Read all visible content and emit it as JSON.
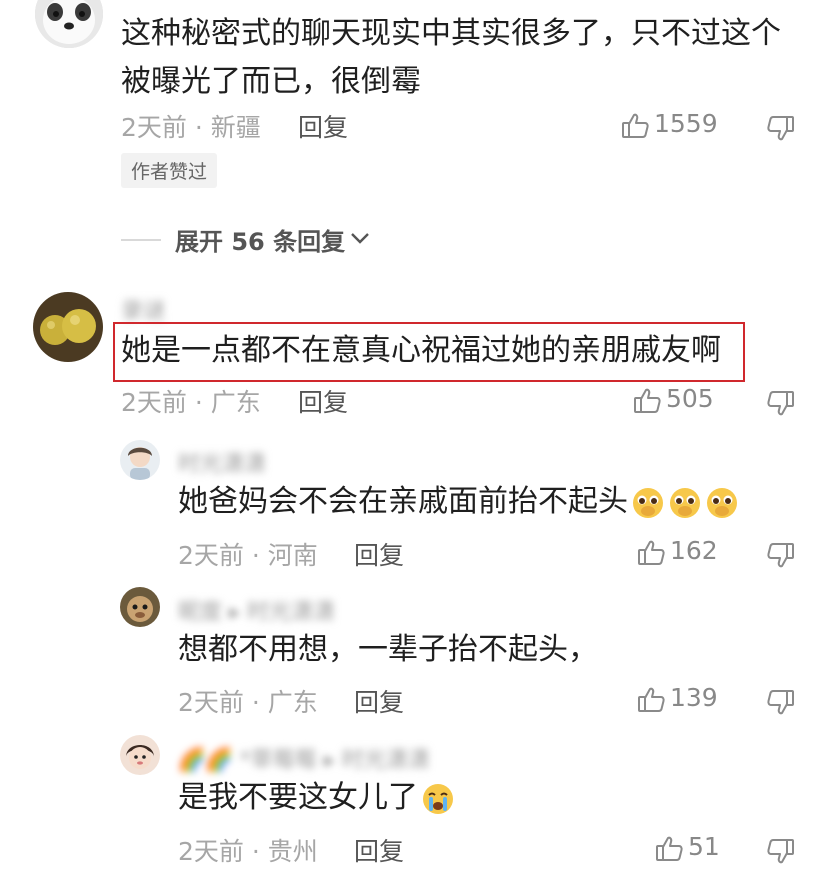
{
  "comments": [
    {
      "text_line1": "这种秘密式的聊天现实中其实很多了，只不过这个",
      "text_line2": "被曝光了而已，很倒霉",
      "time": "2天前",
      "location": "新疆",
      "reply_label": "回复",
      "likes": "1559",
      "badge": "作者赞过",
      "expand_label": "展开 56 条回复"
    },
    {
      "username": "录谜",
      "text": "她是一点都不在意真心祝福过她的亲朋戚友啊",
      "time": "2天前",
      "location": "广东",
      "reply_label": "回复",
      "likes": "505",
      "highlight_color": "#d0282d"
    }
  ],
  "replies": [
    {
      "username": "时光潇潇",
      "text": "她爸妈会不会在亲戚面前抬不起头",
      "time": "2天前",
      "location": "河南",
      "reply_label": "回复",
      "likes": "162"
    },
    {
      "username": "昵度 ▸ 时光潇潇",
      "text": "想都不用想，一辈子抬不起头，",
      "time": "2天前",
      "location": "广东",
      "reply_label": "回复",
      "likes": "139"
    },
    {
      "username": "🌈🌈 *草莓莓 ▸ 时光潇潇",
      "text": "是我不要这女儿了",
      "time": "2天前",
      "location": "贵州",
      "reply_label": "回复",
      "likes": "51"
    }
  ],
  "separator": "·"
}
